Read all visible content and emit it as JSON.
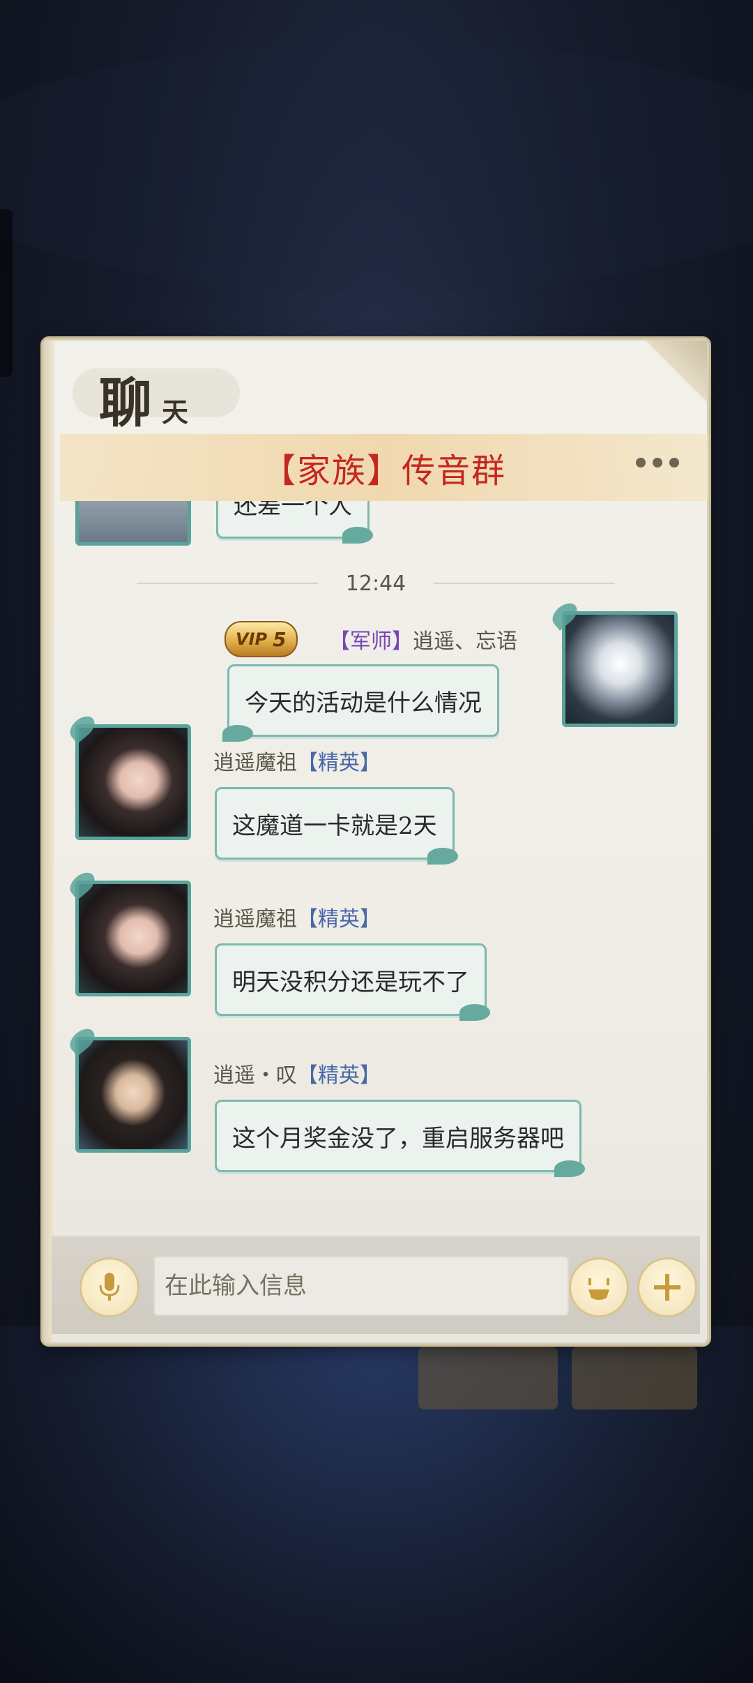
{
  "panel": {
    "title_main": "聊",
    "title_sub": "天",
    "group_title": "【家族】传音群",
    "more_icon": "more-dots-icon"
  },
  "messages": [
    {
      "id": "prev",
      "text": "还差一个人",
      "side": "left"
    },
    {
      "id": "time",
      "timestamp": "12:44"
    },
    {
      "id": "m1",
      "side": "right",
      "vip_label": "VIP",
      "vip_level": "5",
      "role_tag": "【军师】",
      "name": "逍遥、忘语",
      "text": "今天的活动是什么情况"
    },
    {
      "id": "m2",
      "side": "left",
      "name": "逍遥魔祖",
      "role_tag": "【精英】",
      "text": "这魔道一卡就是2天"
    },
    {
      "id": "m3",
      "side": "left",
      "name": "逍遥魔祖",
      "role_tag": "【精英】",
      "text": "明天没积分还是玩不了"
    },
    {
      "id": "m4",
      "side": "left",
      "name": "逍遥・叹",
      "role_tag": "【精英】",
      "text": "这个月奖金没了，重启服务器吧"
    }
  ],
  "input": {
    "placeholder": "在此输入信息",
    "voice_icon": "microphone-icon",
    "emoji_icon": "emoji-face-icon",
    "add_icon": "plus-icon"
  },
  "colors": {
    "group_title": "#c3281f",
    "bubble_border": "#7db8ae",
    "elite_tag": "#4a68a8",
    "adviser_tag": "#7846b4"
  }
}
